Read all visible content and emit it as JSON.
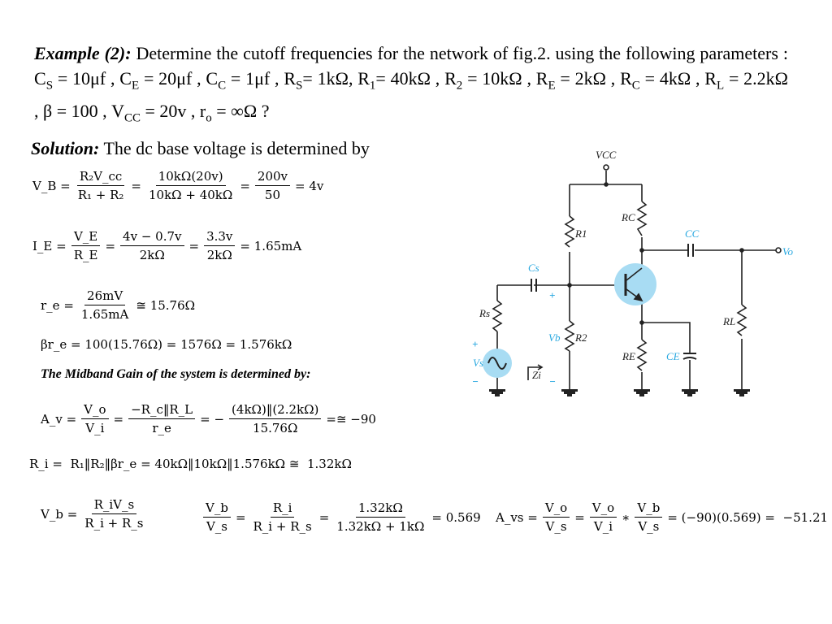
{
  "problem": {
    "label": "Example (2):",
    "text": " Determine the cutoff frequencies for the network of fig.2. using the following parameters : C",
    "parts": [
      "S",
      " = 10μf , C",
      "E",
      " = 20μf , C",
      "C",
      " = 1μf , R",
      "S",
      "= 1kΩ, R",
      "1",
      "= 40kΩ ,  R",
      "2",
      " = 10kΩ , R",
      "E",
      " = 2kΩ , R",
      "C",
      " = 4kΩ , R",
      "L",
      " = 2.2kΩ , β = 100 , V",
      "CC",
      " = 20v , r",
      "o",
      " = ∞Ω ?"
    ]
  },
  "solution": {
    "label": "Solution:",
    "text": " The dc base voltage is determined by"
  },
  "midband_heading": "The Midband Gain of the system is determined by:",
  "equations": [
    [
      "V_B =",
      {
        "num": "R₂V_cc",
        "den": "R₁ + R₂"
      },
      "=",
      {
        "num": "10kΩ(20v)",
        "den": "10kΩ + 40kΩ"
      },
      "=",
      {
        "num": "200v",
        "den": "50"
      },
      "= 4v"
    ],
    [
      "I_E =",
      {
        "num": "V_E",
        "den": "R_E"
      },
      "=",
      {
        "num": "4v − 0.7v",
        "den": "2kΩ"
      },
      "=",
      {
        "num": "3.3v",
        "den": "2kΩ"
      },
      "= 1.65mA"
    ],
    [
      "r_e =",
      {
        "num": "26mV",
        "den": "1.65mA"
      },
      "≅ 15.76Ω"
    ],
    [
      "βr_e = 100(15.76Ω) = 1576Ω = 1.576kΩ"
    ],
    [
      "A_v =",
      {
        "num": "V_o",
        "den": "V_i"
      },
      "=",
      {
        "num": "−R_c‖R_L",
        "den": "r_e"
      },
      "= −",
      {
        "num": "(4kΩ)‖(2.2kΩ)",
        "den": "15.76Ω"
      },
      "=≅ −90"
    ],
    [
      "R_i =  R₁‖R₂‖βr_e = 40kΩ‖10kΩ‖1.576kΩ ≅  1.32kΩ"
    ],
    [
      "V_b =",
      {
        "num": "R_iV_s",
        "den": "R_i + R_s"
      }
    ],
    [
      {
        "num": "V_b",
        "den": "V_s"
      },
      "=",
      {
        "num": "R_i",
        "den": "R_i + R_s"
      },
      "=",
      {
        "num": "1.32kΩ",
        "den": "1.32kΩ + 1kΩ"
      },
      "= 0.569"
    ],
    [
      "A_vs =",
      {
        "num": "V_o",
        "den": "V_s"
      },
      "=",
      {
        "num": "V_o",
        "den": "V_i"
      },
      "∗",
      {
        "num": "V_b",
        "den": "V_s"
      },
      "= (−90)(0.569) =  −51.21"
    ]
  ],
  "circuit": {
    "labels": {
      "vcc": "VCC",
      "r1": "R1",
      "rc": "RC",
      "cc": "CC",
      "vo": "Vo",
      "cs": "Cs",
      "rs": "Rs",
      "vs": "Vs",
      "vb": "Vb",
      "r2": "R2",
      "re": "RE",
      "ce": "CE",
      "rl": "RL",
      "zi": "Zi",
      "plus": "+",
      "minus": "−"
    },
    "colors": {
      "accent": "#29a8e0",
      "fill": "#a8dcf3"
    }
  }
}
